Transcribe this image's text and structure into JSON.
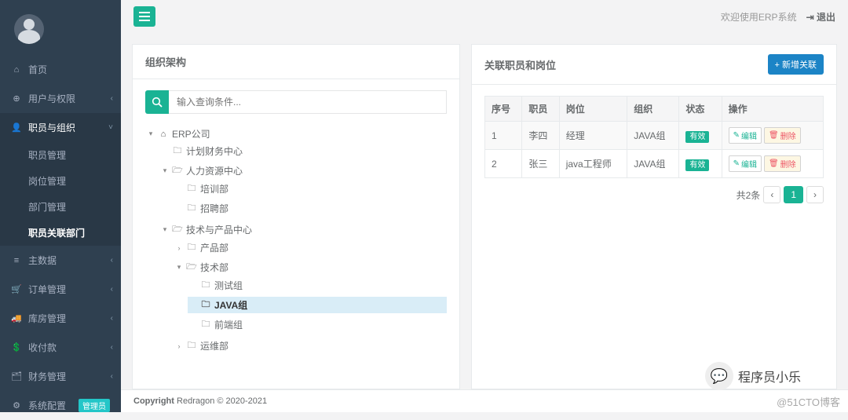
{
  "topbar": {
    "welcome": "欢迎使用ERP系统",
    "logout": "退出"
  },
  "sidebar": {
    "items": [
      {
        "icon": "⌂",
        "label": "首页",
        "chev": ""
      },
      {
        "icon": "⊕",
        "label": "用户与权限",
        "chev": "‹"
      },
      {
        "icon": "👤",
        "label": "职员与组织",
        "chev": "˅",
        "active": true,
        "children": [
          "职员管理",
          "岗位管理",
          "部门管理",
          "职员关联部门"
        ],
        "selected_child": 3
      },
      {
        "icon": "≡",
        "label": "主数据",
        "chev": "‹"
      },
      {
        "icon": "🛒",
        "label": "订单管理",
        "chev": "‹"
      },
      {
        "icon": "🚚",
        "label": "库房管理",
        "chev": "‹"
      },
      {
        "icon": "💲",
        "label": "收付款",
        "chev": "‹"
      },
      {
        "icon": "🗂",
        "label": "财务管理",
        "chev": "‹"
      },
      {
        "icon": "⚙",
        "label": "系统配置",
        "chev": "",
        "badge": "管理员"
      }
    ]
  },
  "left_panel": {
    "title": "组织架构",
    "search_placeholder": "输入查询条件..."
  },
  "tree": {
    "root": {
      "label": "ERP公司",
      "icon": "⌂",
      "expanded": true,
      "children": [
        {
          "label": "计划财务中心",
          "icon": "🗀",
          "expanded": false
        },
        {
          "label": "人力资源中心",
          "icon": "🗁",
          "expanded": true,
          "children": [
            {
              "label": "培训部",
              "icon": "🗀"
            },
            {
              "label": "招聘部",
              "icon": "🗀"
            }
          ]
        },
        {
          "label": "技术与产品中心",
          "icon": "🗁",
          "expanded": true,
          "children": [
            {
              "label": "产品部",
              "icon": "🗀",
              "expanded": false,
              "twist": "›"
            },
            {
              "label": "技术部",
              "icon": "🗁",
              "expanded": true,
              "children": [
                {
                  "label": "测试组",
                  "icon": "🗀"
                },
                {
                  "label": "JAVA组",
                  "icon": "🗀",
                  "selected": true
                },
                {
                  "label": "前端组",
                  "icon": "🗀"
                }
              ]
            },
            {
              "label": "运维部",
              "icon": "🗀",
              "expanded": false,
              "twist": "›"
            }
          ]
        }
      ]
    }
  },
  "right_panel": {
    "title": "关联职员和岗位",
    "add_btn": "+ 新增关联"
  },
  "table": {
    "headers": [
      "序号",
      "职员",
      "岗位",
      "组织",
      "状态",
      "操作"
    ],
    "rows": [
      {
        "no": "1",
        "emp": "李四",
        "post": "经理",
        "org": "JAVA组",
        "status": "有效"
      },
      {
        "no": "2",
        "emp": "张三",
        "post": "java工程师",
        "org": "JAVA组",
        "status": "有效"
      }
    ],
    "ops": {
      "edit": "编辑",
      "del": "删除"
    }
  },
  "pager": {
    "total": "共2条",
    "page": "1"
  },
  "footer": {
    "copyright": "Copyright",
    "text": "Redragon © 2020-2021"
  },
  "watermark": "@51CTO博客",
  "wechat": "程序员小乐"
}
